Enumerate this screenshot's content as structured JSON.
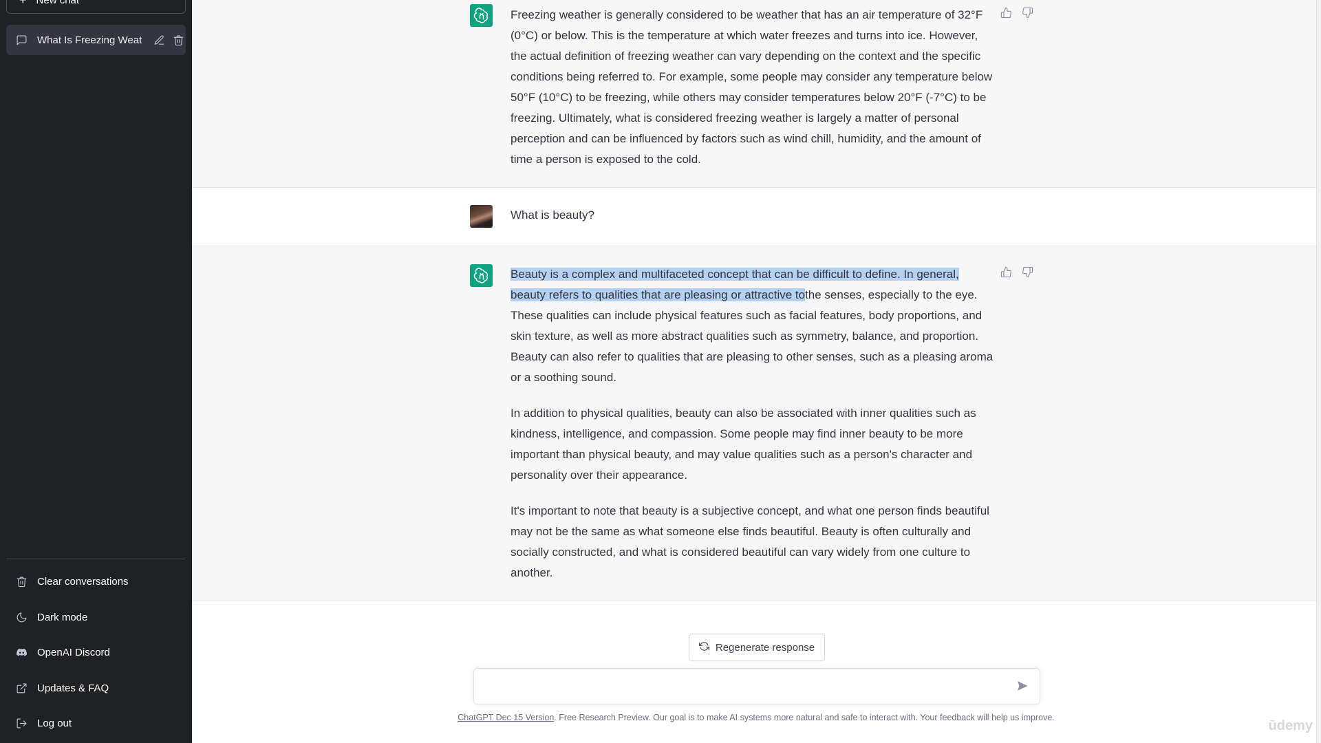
{
  "sidebar": {
    "new_chat_label": "New chat",
    "conversations": [
      {
        "title": "What Is Freezing Weat"
      }
    ],
    "menu": [
      {
        "label": "Clear conversations",
        "icon": "trash-icon"
      },
      {
        "label": "Dark mode",
        "icon": "moon-icon"
      },
      {
        "label": "OpenAI Discord",
        "icon": "discord-icon"
      },
      {
        "label": "Updates & FAQ",
        "icon": "external-link-icon"
      },
      {
        "label": "Log out",
        "icon": "logout-icon"
      }
    ]
  },
  "messages": [
    {
      "role": "assistant",
      "paragraphs": [
        "Freezing weather is generally considered to be weather that has an air temperature of 32°F (0°C) or below. This is the temperature at which water freezes and turns into ice. However, the actual definition of freezing weather can vary depending on the context and the specific conditions being referred to. For example, some people may consider any temperature below 50°F (10°C) to be freezing, while others may consider temperatures below 20°F (-7°C) to be freezing. Ultimately, what is considered freezing weather is largely a matter of personal perception and can be influenced by factors such as wind chill, humidity, and the amount of time a person is exposed to the cold."
      ]
    },
    {
      "role": "user",
      "text": "What is beauty?"
    },
    {
      "role": "assistant",
      "highlighted": "Beauty is a complex and multifaceted concept that can be difficult to define. In general, beauty refers to qualities that are pleasing or attractive to",
      "first_rest": "the senses, especially to the eye. These qualities can include physical features such as facial features, body proportions, and skin texture, as well as more abstract qualities such as symmetry, balance, and proportion. Beauty can also refer to qualities that are pleasing to other senses, such as a pleasing aroma or a soothing sound.",
      "paragraphs": [
        "In addition to physical qualities, beauty can also be associated with inner qualities such as kindness, intelligence, and compassion. Some people may find inner beauty to be more important than physical beauty, and may value qualities such as a person's character and personality over their appearance.",
        "It's important to note that beauty is a subjective concept, and what one person finds beautiful may not be the same as what someone else finds beautiful. Beauty is often culturally and socially constructed, and what is considered beautiful can vary widely from one culture to another."
      ]
    }
  ],
  "composer": {
    "regenerate_label": "Regenerate response",
    "input_value": "",
    "input_placeholder": ""
  },
  "footer": {
    "version_link": "ChatGPT Dec 15 Version",
    "text": ". Free Research Preview. Our goal is to make AI systems more natural and safe to interact with. Your feedback will help us improve."
  },
  "watermark": "ūdemy",
  "colors": {
    "sidebar_bg": "#202123",
    "assistant_row_bg": "#f7f7f8",
    "assistant_avatar": "#10a37f",
    "selection_highlight": "#b4d1f2"
  }
}
